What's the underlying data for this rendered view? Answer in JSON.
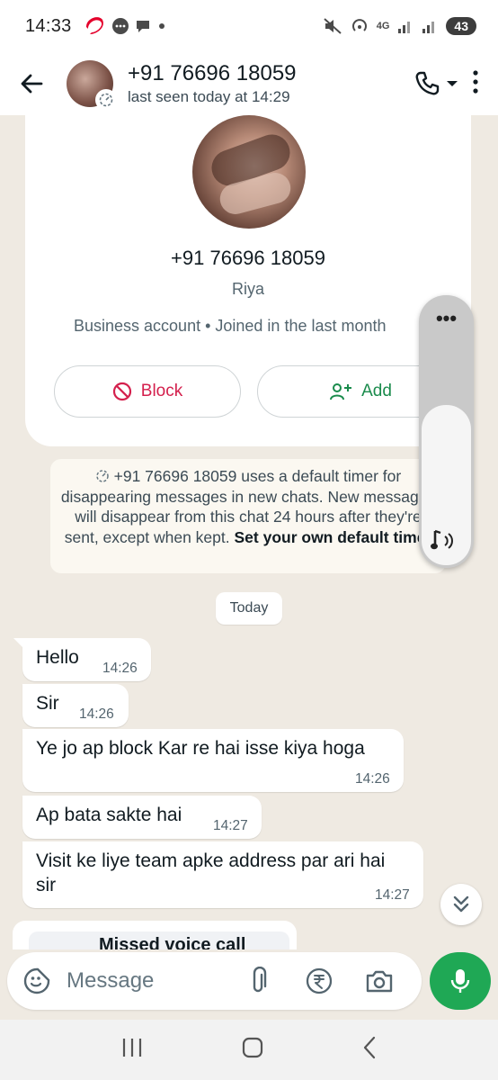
{
  "status_bar": {
    "time": "14:33",
    "network": "4G",
    "battery": "43"
  },
  "header": {
    "contact_phone": "+91 76696 18059",
    "last_seen": "last seen today at 14:29"
  },
  "contact_card": {
    "phone": "+91 76696 18059",
    "name": "Riya",
    "business_info": "Business account • Joined in the last month",
    "block_label": "Block",
    "add_label": "Add"
  },
  "system_note": {
    "text": "+91 76696 18059 uses a default timer for disappearing messages in new chats. New messages will disappear from this chat 24 hours after they're sent, except when kept.",
    "link": "Set your own default timer"
  },
  "date_chip": "Today",
  "messages": [
    {
      "text": "Hello",
      "time": "14:26"
    },
    {
      "text": "Sir",
      "time": "14:26"
    },
    {
      "text": "Ye jo ap block Kar re hai isse kiya hoga",
      "time": "14:26"
    },
    {
      "text": "Ap bata sakte hai",
      "time": "14:27"
    },
    {
      "text": "Visit ke liye team apke address par ari hai sir",
      "time": "14:27"
    }
  ],
  "partial_message": "Missed voice call",
  "compose": {
    "placeholder": "Message"
  },
  "volume": {
    "level": 0.6
  },
  "colors": {
    "chat_bg": "#efeae2",
    "accent_green": "#1fa855",
    "block_red": "#d4204d",
    "add_green": "#1a8b4c"
  }
}
